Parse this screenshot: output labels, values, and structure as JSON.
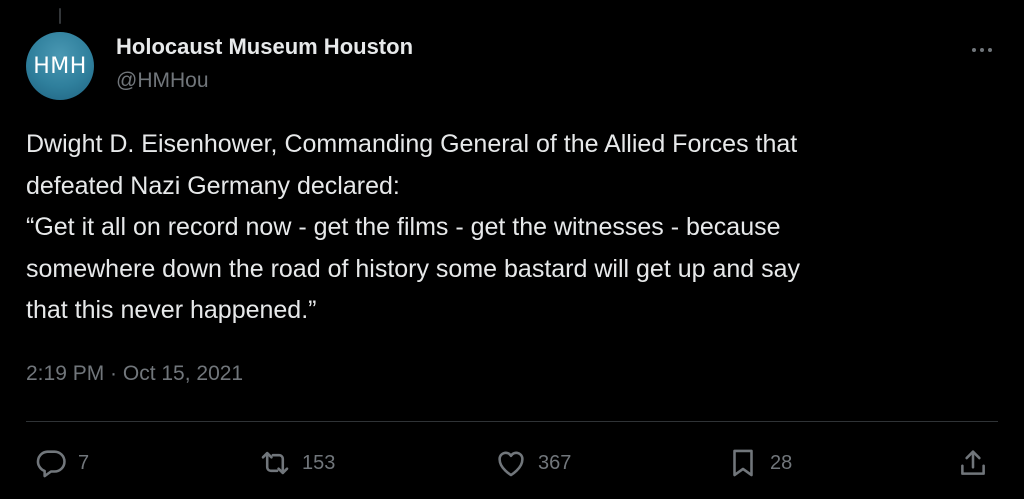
{
  "author": {
    "avatar_text": "HMH",
    "display_name": "Holocaust Museum Houston",
    "handle": "@HMHou"
  },
  "tweet": {
    "lines": [
      "Dwight D. Eisenhower, Commanding General of the Allied Forces that",
      "defeated Nazi Germany declared:",
      "“Get it all on record now - get the films - get the witnesses - because",
      "somewhere down the road of history some bastard will get up and say",
      "that this never happened.”"
    ],
    "timestamp": "2:19 PM · Oct 15, 2021"
  },
  "actions": {
    "replies": "7",
    "retweets": "153",
    "likes": "367",
    "bookmarks": "28"
  },
  "icons": [
    "more-icon",
    "reply-icon",
    "retweet-icon",
    "like-icon",
    "bookmark-icon",
    "share-icon"
  ],
  "colors": {
    "background": "#000000",
    "text": "#e7e9ea",
    "secondary": "#71767b",
    "divider": "#2f3336",
    "avatar": "#2f7f9c"
  }
}
